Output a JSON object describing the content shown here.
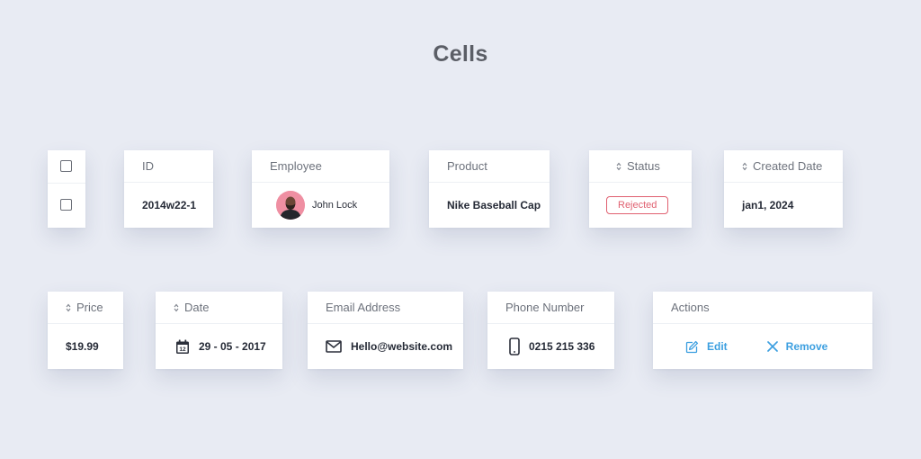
{
  "page": {
    "title": "Cells"
  },
  "cells": {
    "id": {
      "header": "ID",
      "value": "2014w22-1"
    },
    "employee": {
      "header": "Employee",
      "name": "John Lock"
    },
    "product": {
      "header": "Product",
      "value": "Nike Baseball Cap"
    },
    "status": {
      "header": "Status",
      "value": "Rejected",
      "color": "#e06070"
    },
    "created_date": {
      "header": "Created Date",
      "value": "jan1, 2024"
    },
    "price": {
      "header": "Price",
      "value": "$19.99"
    },
    "date": {
      "header": "Date",
      "value": "29 - 05 - 2017",
      "icon": "calendar-icon",
      "icon_day": "12"
    },
    "email": {
      "header": "Email Address",
      "value": "Hello@website.com",
      "icon": "mail-icon"
    },
    "phone": {
      "header": "Phone Number",
      "value": "0215 215 336",
      "icon": "phone-icon"
    },
    "actions": {
      "header": "Actions",
      "edit_label": "Edit",
      "remove_label": "Remove",
      "accent": "#3c9fe0"
    }
  }
}
